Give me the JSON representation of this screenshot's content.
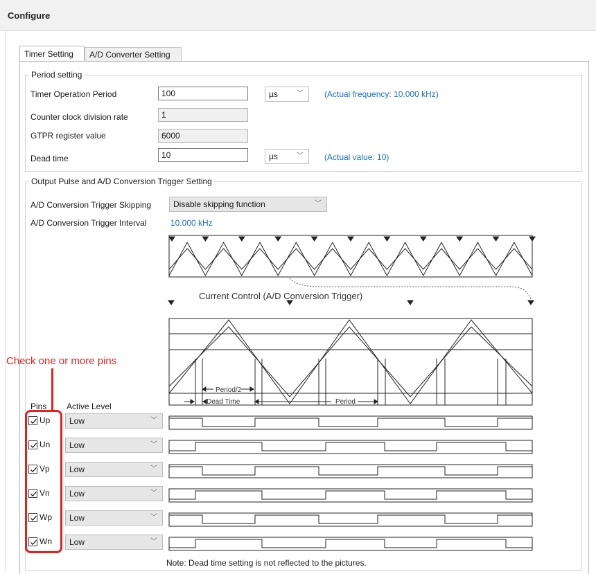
{
  "window": {
    "title": "Configure"
  },
  "tabs": [
    {
      "label": "Timer Setting",
      "active": true
    },
    {
      "label": "A/D Converter Setting",
      "active": false
    }
  ],
  "period": {
    "group_label": "Period setting",
    "timer_period": {
      "label": "Timer Operation Period",
      "value": "100",
      "unit": "µs",
      "note": "(Actual frequency: 10.000 kHz)"
    },
    "division": {
      "label": "Counter clock division rate",
      "value": "1"
    },
    "gtpr": {
      "label": "GTPR register value",
      "value": "6000"
    },
    "dead_time": {
      "label": "Dead time",
      "value": "10",
      "unit": "µs",
      "note": "(Actual value: 10)"
    }
  },
  "output": {
    "group_label": "Output Pulse and A/D Conversion Trigger Setting",
    "skipping": {
      "label": "A/D Conversion Trigger Skipping",
      "value": "Disable skipping function"
    },
    "interval": {
      "label": "A/D Conversion Trigger Interval",
      "value": "10.000 kHz"
    },
    "diagram": {
      "current_control_label": "Current Control (A/D Conversion Trigger)",
      "period_half_label": "Period/2",
      "dead_time_label": "Dead Time",
      "period_label": "Period"
    },
    "pins_header": "Pins",
    "active_level_header": "Active Level",
    "pins": [
      {
        "name": "Up",
        "checked": true,
        "level": "Low"
      },
      {
        "name": "Un",
        "checked": true,
        "level": "Low"
      },
      {
        "name": "Vp",
        "checked": true,
        "level": "Low"
      },
      {
        "name": "Vn",
        "checked": true,
        "level": "Low"
      },
      {
        "name": "Wp",
        "checked": true,
        "level": "Low"
      },
      {
        "name": "Wn",
        "checked": true,
        "level": "Low"
      }
    ],
    "note": "Note: Dead time setting is not reflected to the pictures."
  },
  "annotation": {
    "text": "Check one or more pins",
    "color": "#e8201d"
  },
  "colors": {
    "link_blue": "#1a6fc4",
    "annotation_red": "#e8201d"
  }
}
